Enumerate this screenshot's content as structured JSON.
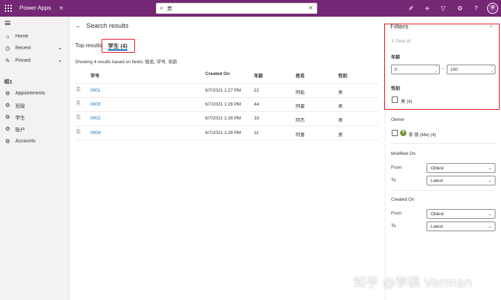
{
  "header": {
    "app_name": "Power Apps",
    "environment": "tt",
    "search_value": "男",
    "icons": [
      "waffle-icon",
      "search-icon",
      "clear-icon",
      "assistant-icon",
      "add-icon",
      "filter-icon",
      "settings-icon",
      "help-icon"
    ],
    "avatar_initial": "李"
  },
  "sidebar": {
    "items": [
      {
        "label": "Home",
        "icon": "home-icon"
      },
      {
        "label": "Recent",
        "icon": "clock-icon"
      },
      {
        "label": "Pinned",
        "icon": "pin-icon"
      }
    ],
    "group_title": "组1",
    "group_items": [
      {
        "label": "Appointments",
        "icon": "entity-icon"
      },
      {
        "label": "班级",
        "icon": "entity-icon"
      },
      {
        "label": "学生",
        "icon": "entity-icon"
      },
      {
        "label": "账户",
        "icon": "entity-icon"
      },
      {
        "label": "Accounts",
        "icon": "entity-icon"
      }
    ]
  },
  "main": {
    "title": "Search results",
    "tabs": [
      {
        "label": "Top results"
      },
      {
        "label": "学生 (4)"
      }
    ],
    "showing_text": "Showing 4 results based on fields: 姓名, 学号, 年龄",
    "columns": [
      "学号",
      "Created On",
      "年龄",
      "姓名",
      "性别"
    ],
    "rows": [
      {
        "id": "0001",
        "created": "6/7/2021 1:27 PM",
        "age": "22",
        "name": "阿彪",
        "gender": "男"
      },
      {
        "id": "0003",
        "created": "6/7/2021 1:28 PM",
        "age": "44",
        "name": "阿豪",
        "gender": "男"
      },
      {
        "id": "0002",
        "created": "6/7/2021 1:28 PM",
        "age": "33",
        "name": "阿杰",
        "gender": "男"
      },
      {
        "id": "0004",
        "created": "6/7/2021 1:28 PM",
        "age": "11",
        "name": "阿喜",
        "gender": "男"
      }
    ]
  },
  "filters": {
    "title": "Filters",
    "clear_all": "Clear all",
    "age_label": "年龄",
    "age_min": "0",
    "age_max": "100",
    "range_dash": "-",
    "gender_label": "性别",
    "gender_option": "男 (4)",
    "owner_label": "Owner",
    "owner_option": "李 祺 (Me) (4)",
    "owner_avatar": "李",
    "modified_label": "Modified On",
    "created_label": "Created On",
    "from_label": "From",
    "to_label": "To",
    "modified_from": "Oldest",
    "modified_to": "Latest",
    "created_from": "Oldest",
    "created_to": "Latest"
  },
  "watermark": "知乎 @李祺 Varman",
  "colors": {
    "header_bg": "#742774",
    "link": "#0f6cbd",
    "highlight_border": "#e81123"
  }
}
